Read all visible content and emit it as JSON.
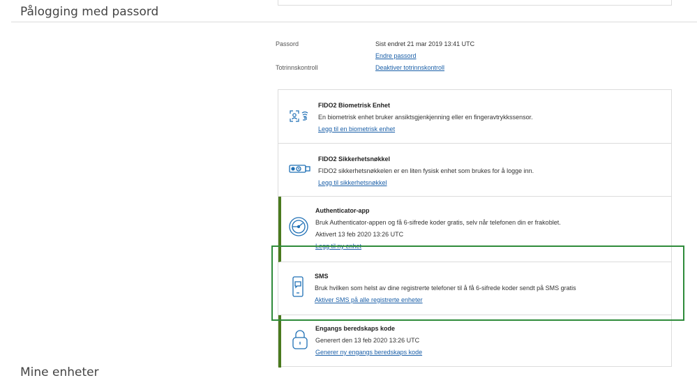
{
  "sections": {
    "password_login": "Pålogging med passord",
    "my_devices": "Mine enheter"
  },
  "account": {
    "password_label": "Passord",
    "password_status": "Sist endret 21 mar 2019 13:41 UTC",
    "change_password_link": "Endre passord",
    "two_factor_label": "Totrinnskontroll",
    "disable_two_factor_link": "Deaktiver totrinnskontroll"
  },
  "methods": [
    {
      "title": "FIDO2 Biometrisk Enhet",
      "description": "En biometrisk enhet bruker ansiktsgjenkjenning eller en fingeravtrykkssensor.",
      "link": "Legg til en biometrisk enhet",
      "icon": "biometric-icon",
      "active": false
    },
    {
      "title": "FIDO2 Sikkerhetsnøkkel",
      "description": "FIDO2 sikkerhetsnøkkelen er en liten fysisk enhet som brukes for å logge inn.",
      "link": "Legg til sikkerhetsnøkkel",
      "icon": "security-key-icon",
      "active": false
    },
    {
      "title": "Authenticator-app",
      "description": "Bruk Authenticator-appen og få 6-sifrede koder gratis, selv når telefonen din er frakoblet.",
      "status": "Aktivert 13 feb 2020 13:26 UTC",
      "link": "Legg til ny enhet",
      "icon": "authenticator-icon",
      "active": true
    },
    {
      "title": "SMS",
      "description": "Bruk hvilken som helst av dine registrerte telefoner til å få 6-sifrede koder sendt på SMS gratis",
      "link": "Aktiver SMS på alle registrerte enheter",
      "icon": "phone-sms-icon",
      "active": false
    },
    {
      "title": "Engangs beredskaps kode",
      "status": "Generert den 13 feb 2020 13:26 UTC",
      "link": "Generer ny engangs beredskaps kode",
      "icon": "padlock-icon",
      "active": true
    }
  ],
  "colors": {
    "link": "#1a5fa8",
    "active_bar": "#4a7a1e",
    "highlight": "#2e8b3a",
    "icon": "#1e6fb5"
  }
}
